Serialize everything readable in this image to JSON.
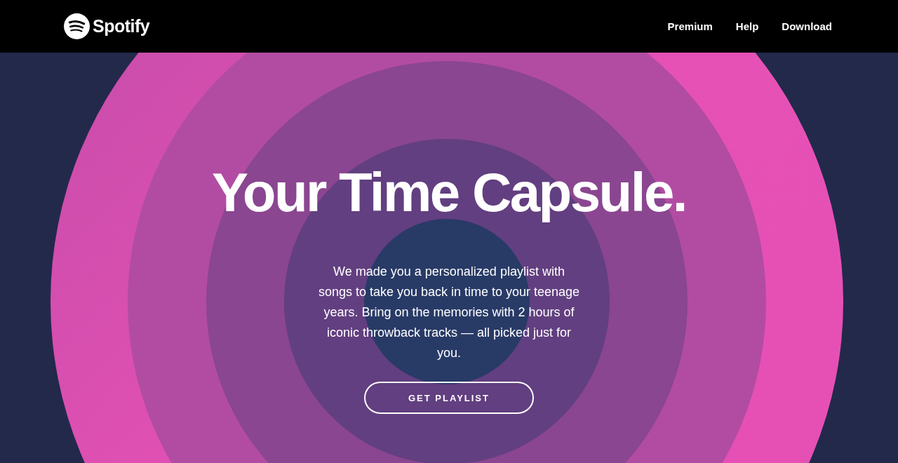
{
  "header": {
    "logo": "Spotify",
    "nav": [
      {
        "label": "Premium"
      },
      {
        "label": "Help"
      },
      {
        "label": "Download"
      }
    ]
  },
  "hero": {
    "title": "Your Time Capsule.",
    "text": "We made you a personalized playlist with songs to take you back in time to your teenage years. Bring on the memories with 2 hours of iconic throwback tracks — all picked just for you.",
    "button": "GET PLAYLIST"
  }
}
